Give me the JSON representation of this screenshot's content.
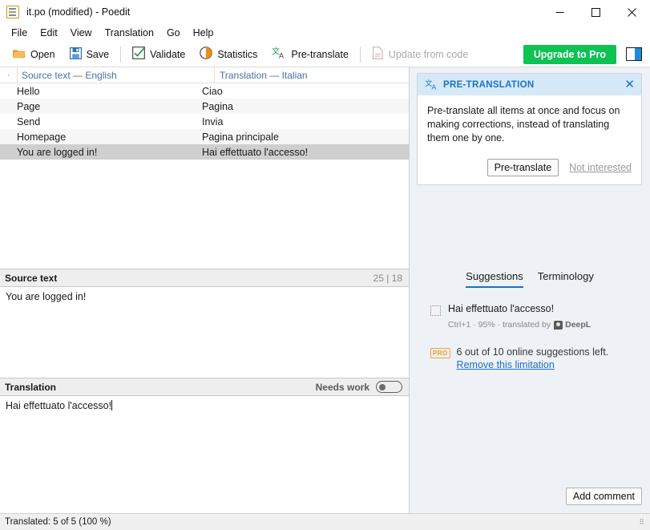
{
  "window": {
    "title": "it.po (modified) - Poedit",
    "app_icon": "poedit-list-icon",
    "minimize": "—",
    "maximize": "□",
    "close": "✕"
  },
  "menubar": {
    "items": [
      {
        "label": "File"
      },
      {
        "label": "Edit"
      },
      {
        "label": "View"
      },
      {
        "label": "Translation"
      },
      {
        "label": "Go"
      },
      {
        "label": "Help"
      }
    ]
  },
  "toolbar": {
    "open_label": "Open",
    "save_label": "Save",
    "validate_label": "Validate",
    "statistics_label": "Statistics",
    "pretranslate_label": "Pre-translate",
    "update_from_code_label": "Update from code",
    "upgrade_label": "Upgrade to Pro",
    "upgrade_color": "#0ec254",
    "sidebar_toggle_color": "#1c8ae0"
  },
  "list": {
    "dot_header": "·",
    "columns": {
      "source": "Source text — English",
      "translation": "Translation — Italian"
    },
    "rows": [
      {
        "source": "Hello",
        "translation": "Ciao",
        "selected": false
      },
      {
        "source": "Page",
        "translation": "Pagina",
        "selected": false
      },
      {
        "source": "Send",
        "translation": "Invia",
        "selected": false
      },
      {
        "source": "Homepage",
        "translation": "Pagina principale",
        "selected": false
      },
      {
        "source": "You are logged in!",
        "translation": "Hai effettuato l'accesso!",
        "selected": true
      }
    ]
  },
  "source_pane": {
    "title": "Source text",
    "counts": "25 | 18",
    "text": "You are logged in!"
  },
  "translation_pane": {
    "title": "Translation",
    "needs_work_label": "Needs work",
    "needs_work_on": false,
    "text": "Hai effettuato l'accesso!"
  },
  "sidebar": {
    "pretranslation_card": {
      "title": "PRE-TRANSLATION",
      "icon": "translate-icon",
      "close_icon": "✕",
      "body": "Pre-translate all items at once and focus on making corrections, instead of translating them one by one.",
      "primary_button": "Pre-translate",
      "secondary_link": "Not interested",
      "header_color": "#d6e9f8",
      "title_color": "#1a72c4"
    },
    "tabs": [
      {
        "label": "Suggestions",
        "active": true
      },
      {
        "label": "Terminology",
        "active": false
      }
    ],
    "suggestion": {
      "text": "Hai effettuato l'accesso!",
      "shortcut": "Ctrl+1",
      "match": "95%",
      "attribution_prefix": "translated by",
      "provider": "DeepL",
      "meta": "Ctrl+1 · 95% · translated by"
    },
    "limitation": {
      "badge": "PRO",
      "text": "6 out of 10 online suggestions left.",
      "link": "Remove this limitation",
      "link_color": "#1a72c4",
      "badge_color": "#e89a2a"
    },
    "add_comment_label": "Add comment"
  },
  "statusbar": {
    "text": "Translated: 5 of 5 (100 %)"
  }
}
